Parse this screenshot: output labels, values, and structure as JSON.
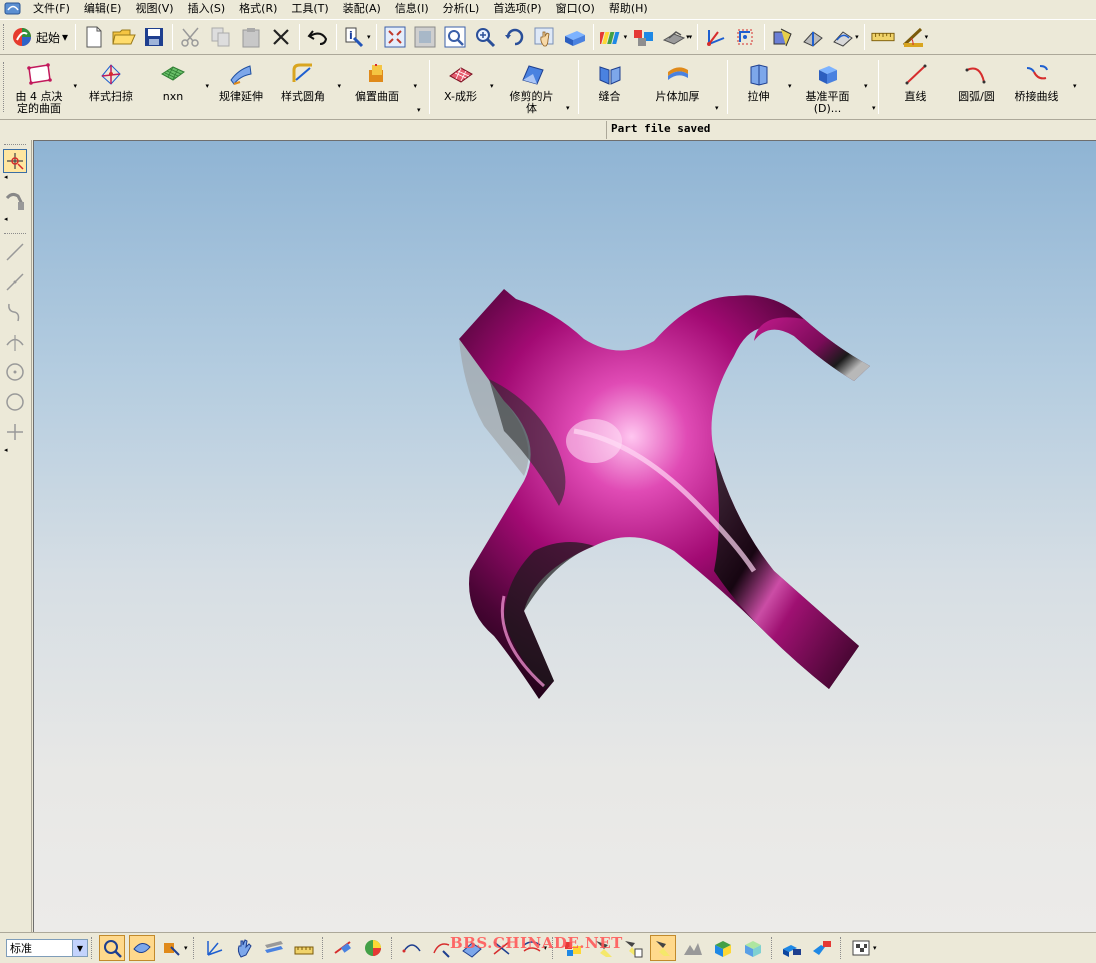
{
  "menu": {
    "items": [
      "文件(F)",
      "编辑(E)",
      "视图(V)",
      "插入(S)",
      "格式(R)",
      "工具(T)",
      "装配(A)",
      "信息(I)",
      "分析(L)",
      "首选项(P)",
      "窗口(O)",
      "帮助(H)"
    ]
  },
  "toolbar": {
    "start_label": "起始"
  },
  "surface_toolbar": {
    "buttons": [
      {
        "label": "由 4 点决\n定的曲面",
        "icon": "four-point-surface-icon"
      },
      {
        "label": "样式扫掠",
        "icon": "styled-sweep-icon"
      },
      {
        "label": "nxn",
        "icon": "nxn-surface-icon"
      },
      {
        "label": "规律延伸",
        "icon": "law-extension-icon"
      },
      {
        "label": "样式圆角",
        "icon": "styled-blend-icon"
      },
      {
        "label": "偏置曲面",
        "icon": "offset-surface-icon"
      },
      {
        "label": "X-成形",
        "icon": "x-form-icon"
      },
      {
        "label": "修剪的片\n体",
        "icon": "trimmed-sheet-icon"
      },
      {
        "label": "缝合",
        "icon": "sew-icon"
      },
      {
        "label": "片体加厚",
        "icon": "thicken-sheet-icon"
      },
      {
        "label": "拉伸",
        "icon": "extrude-icon"
      },
      {
        "label": "基准平面\n(D)...",
        "icon": "datum-plane-icon"
      },
      {
        "label": "直线",
        "icon": "line-icon"
      },
      {
        "label": "圆弧/圆",
        "icon": "arc-circle-icon"
      },
      {
        "label": "桥接曲线",
        "icon": "bridge-curve-icon"
      }
    ]
  },
  "status": {
    "message": "Part file saved"
  },
  "bottom": {
    "view_style": "标准",
    "watermark": "BBS.CHINADE.NET"
  },
  "colors": {
    "ui_face": "#ece9d8",
    "model_magenta": "#b0137e",
    "viewport_top": "#8fb4d4",
    "viewport_bottom": "#ecebe9"
  }
}
